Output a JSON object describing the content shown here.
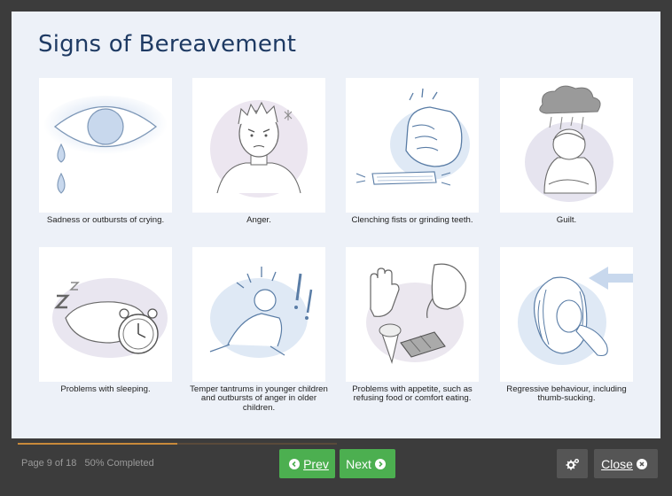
{
  "slide": {
    "title": "Signs of Bereavement",
    "cards": [
      {
        "caption": "Sadness or outbursts of crying.",
        "image": "crying-eye-illustration"
      },
      {
        "caption": "Anger.",
        "image": "angry-boy-illustration"
      },
      {
        "caption": "Clenching fists or grinding teeth.",
        "image": "clenched-fist-illustration"
      },
      {
        "caption": "Guilt.",
        "image": "guilty-child-illustration"
      },
      {
        "caption": "Problems with sleeping.",
        "image": "pillow-alarm-clock-illustration"
      },
      {
        "caption": "Temper tantrums in younger children and outbursts of anger in older children.",
        "image": "tantrum-toddler-illustration"
      },
      {
        "caption": "Problems with appetite, such as refusing food or comfort eating.",
        "image": "food-refusal-illustration"
      },
      {
        "caption": "Regressive behaviour, including thumb-sucking.",
        "image": "thumb-sucking-girl-illustration"
      }
    ]
  },
  "player": {
    "page_text": "Page 9 of 18",
    "completed_text": "50% Completed",
    "progress_fraction": 0.5,
    "prev_label": "Prev",
    "next_label": "Next",
    "close_label": "Close",
    "settings_icon": "settings-gears-icon",
    "colors": {
      "button_green": "#4caf50",
      "progress": "#c98a3a",
      "title": "#1e3a63"
    }
  }
}
